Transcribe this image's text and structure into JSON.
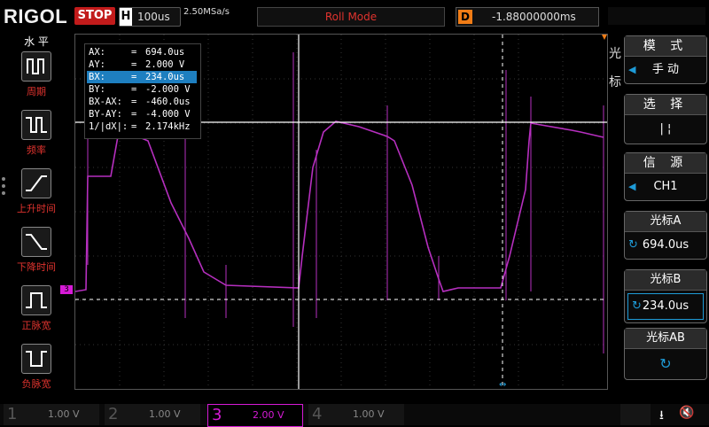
{
  "top": {
    "logo": "RIGOL",
    "run_state": "STOP",
    "timebase_key": "H",
    "timebase_value": "100us",
    "sample_rate": "2.50MSa/s",
    "mode": "Roll Mode",
    "delay_key": "D",
    "delay_value": "-1.88000000ms"
  },
  "left_menu": {
    "title": "水 平",
    "items": [
      {
        "label": "周期",
        "icon": "period-icon"
      },
      {
        "label": "频率",
        "icon": "frequency-icon"
      },
      {
        "label": "上升时间",
        "icon": "rise-time-icon"
      },
      {
        "label": "下降时间",
        "icon": "fall-time-icon"
      },
      {
        "label": "正脉宽",
        "icon": "positive-width-icon"
      },
      {
        "label": "负脉宽",
        "icon": "negative-width-icon"
      }
    ]
  },
  "cursor_readout": [
    {
      "name": "AX:",
      "eq": "=",
      "value": "694.0us",
      "selected": false
    },
    {
      "name": "AY:",
      "eq": "=",
      "value": "2.000 V",
      "selected": false
    },
    {
      "name": "BX:",
      "eq": "=",
      "value": "234.0us",
      "selected": true
    },
    {
      "name": "BY:",
      "eq": "=",
      "value": "-2.000 V",
      "selected": false
    },
    {
      "name": "BX-AX:",
      "eq": "=",
      "value": "-460.0us",
      "selected": false
    },
    {
      "name": "BY-AY:",
      "eq": "=",
      "value": "-4.000 V",
      "selected": false
    },
    {
      "name": "1/|dX|:",
      "eq": "=",
      "value": "2.174kHz",
      "selected": false
    }
  ],
  "channel_marker": "3",
  "right_menu": {
    "side_title_1": "光",
    "side_title_2": "标",
    "mode_label": "模 式",
    "mode_value": "手 动",
    "select_label": "选 择",
    "select_value": "| ¦",
    "source_label": "信 源",
    "source_value": "CH1",
    "cursor_a_label": "光标A",
    "cursor_a_value": "694.0us",
    "cursor_b_label": "光标B",
    "cursor_b_value": "234.0us",
    "cursor_ab_label": "光标AB"
  },
  "channels": [
    {
      "num": "1",
      "value": "1.00 V",
      "color": "#555555",
      "active": false
    },
    {
      "num": "2",
      "value": "1.00 V",
      "color": "#555555",
      "active": false
    },
    {
      "num": "3",
      "value": "2.00 V",
      "color": "#d61ad6",
      "active": true
    },
    {
      "num": "4",
      "value": "1.00 V",
      "color": "#555555",
      "active": false
    }
  ],
  "colors": {
    "trace": "#b62fbf",
    "accent_red": "#e0332e",
    "accent_orange": "#f07c16",
    "accent_blue": "#1e7fc0"
  }
}
